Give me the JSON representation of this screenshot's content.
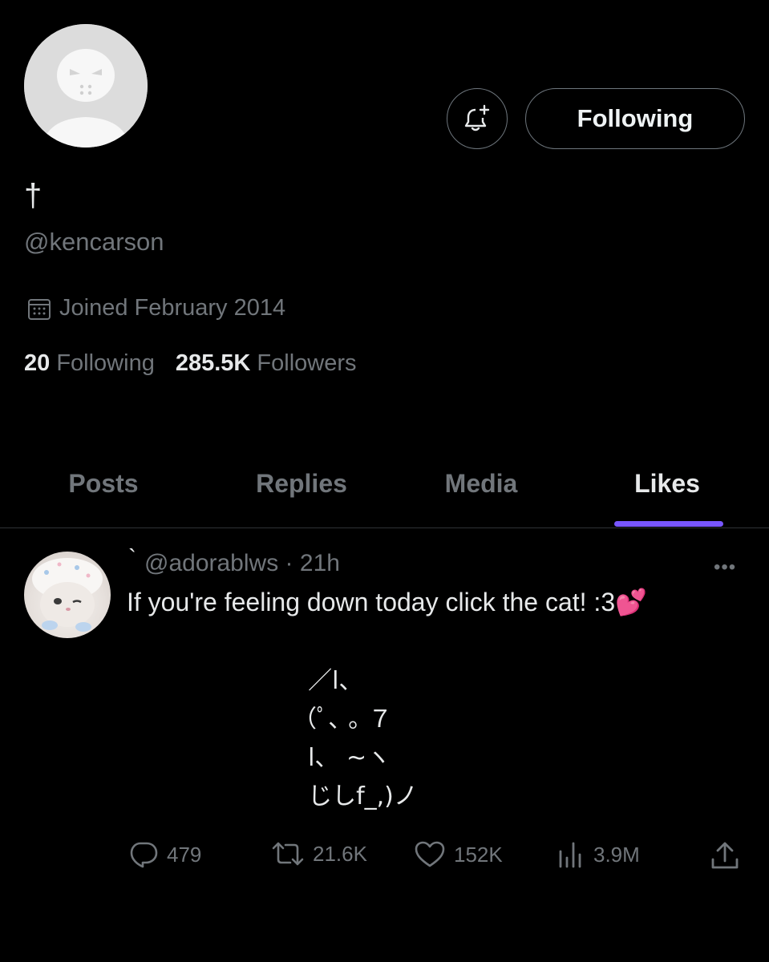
{
  "header": {
    "following_button_label": "Following"
  },
  "profile": {
    "display_name": "†",
    "handle": "@kencarson",
    "joined": "Joined February 2014",
    "following_count": "20",
    "following_label": "Following",
    "followers_count": "285.5K",
    "followers_label": "Followers"
  },
  "tabs": [
    {
      "label": "Posts",
      "active": false
    },
    {
      "label": "Replies",
      "active": false
    },
    {
      "label": "Media",
      "active": false
    },
    {
      "label": "Likes",
      "active": true
    }
  ],
  "tweet": {
    "name_mark": "`",
    "handle": "@adorablws",
    "separator": "·",
    "time": "21h",
    "text": "If you're feeling down today click the cat! :3",
    "emoji": "💕",
    "ascii_art": "  ／l、\n（ﾟ､ ｡ ７\n  l、 ~ヽ\n  じしf_,)ノ",
    "stats": {
      "replies": "479",
      "reposts": "21.6K",
      "likes": "152K",
      "views": "3.9M"
    }
  },
  "colors": {
    "background": "#000000",
    "primary_text": "#e7e9ea",
    "secondary_text": "#71767b",
    "accent": "#7856ff",
    "divider": "#2f3336"
  },
  "icons": [
    "notification-add-icon",
    "calendar-icon",
    "more-icon",
    "reply-icon",
    "repost-icon",
    "like-icon",
    "views-icon",
    "share-icon"
  ]
}
